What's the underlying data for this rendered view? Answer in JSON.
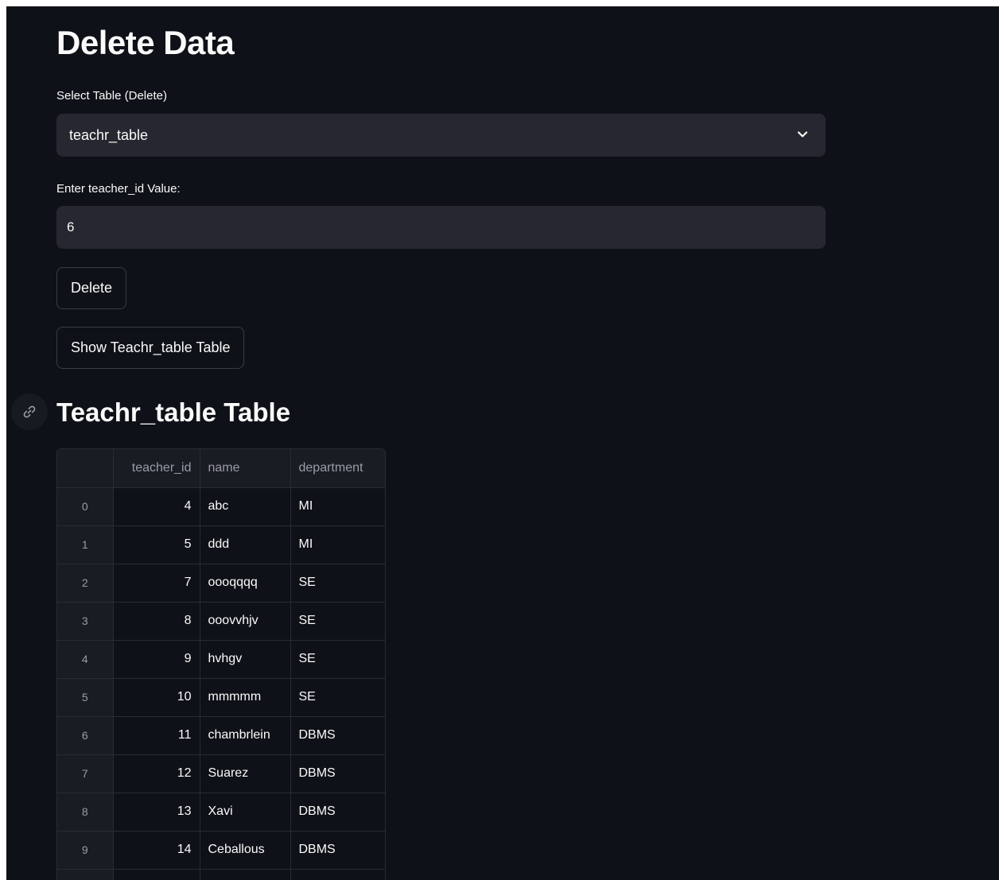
{
  "page": {
    "title": "Delete Data"
  },
  "form": {
    "select_label": "Select Table (Delete)",
    "select_value": "teachr_table",
    "input_label": "Enter teacher_id Value:",
    "input_value": "6",
    "delete_button": "Delete",
    "show_button": "Show Teachr_table Table"
  },
  "section": {
    "title": "Teachr_table Table"
  },
  "table": {
    "columns": [
      "",
      "teacher_id",
      "name",
      "department"
    ],
    "rows": [
      {
        "index": "0",
        "teacher_id": "4",
        "name": "abc",
        "department": "MI"
      },
      {
        "index": "1",
        "teacher_id": "5",
        "name": "ddd",
        "department": "MI"
      },
      {
        "index": "2",
        "teacher_id": "7",
        "name": "oooqqqq",
        "department": "SE"
      },
      {
        "index": "3",
        "teacher_id": "8",
        "name": "ooovvhjv",
        "department": "SE"
      },
      {
        "index": "4",
        "teacher_id": "9",
        "name": "hvhgv",
        "department": "SE"
      },
      {
        "index": "5",
        "teacher_id": "10",
        "name": "mmmmm",
        "department": "SE"
      },
      {
        "index": "6",
        "teacher_id": "11",
        "name": "chambrlein",
        "department": "DBMS"
      },
      {
        "index": "7",
        "teacher_id": "12",
        "name": "Suarez",
        "department": "DBMS"
      },
      {
        "index": "8",
        "teacher_id": "13",
        "name": "Xavi",
        "department": "DBMS"
      },
      {
        "index": "9",
        "teacher_id": "14",
        "name": "Ceballous",
        "department": "DBMS"
      },
      {
        "index": "",
        "teacher_id": "",
        "name": "",
        "department": ""
      }
    ]
  },
  "icons": {
    "select_chevron": "chevron-down-icon",
    "header_anchor": "link-icon"
  },
  "colors": {
    "background": "#0e1117",
    "input_background": "#262730",
    "text": "#fafafa",
    "muted_text": "#9a9ca6",
    "border": "#2a2c35"
  }
}
